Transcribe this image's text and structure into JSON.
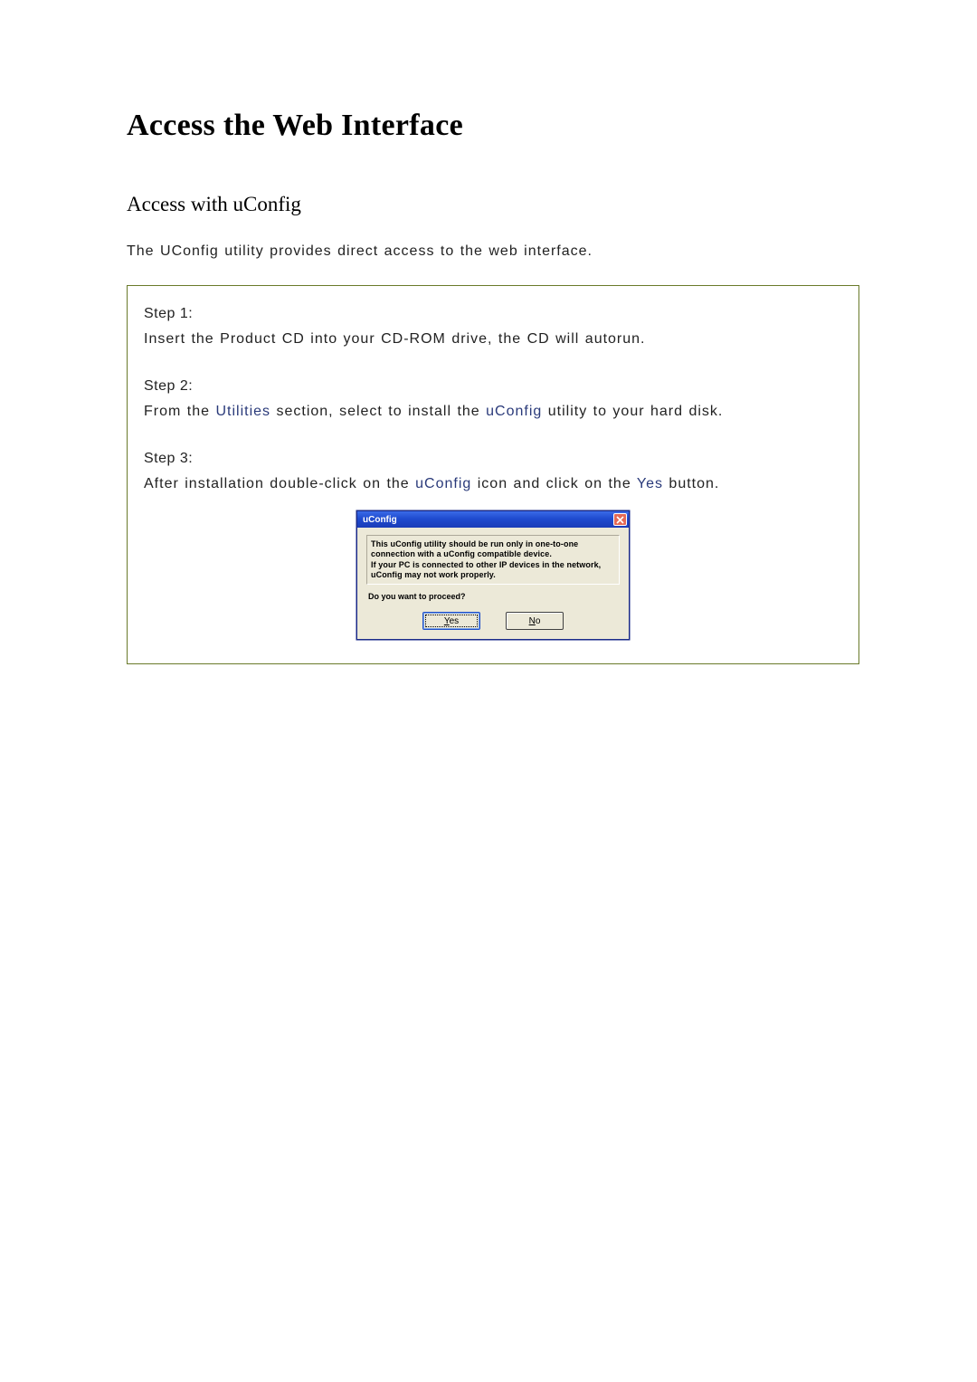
{
  "title": "Access the Web Interface",
  "subtitle": "Access with uConfig",
  "intro": "The UConfig utility provides direct access to the web interface.",
  "steps": {
    "s1": {
      "label": "Step 1:",
      "body": "Insert the Product CD into your CD-ROM drive, the CD will autorun."
    },
    "s2": {
      "label": "Step 2:",
      "pre": "From the ",
      "kw1": "Utilities",
      "mid": " section, select to install the ",
      "kw2": "uConfig",
      "post": " utility to your hard disk."
    },
    "s3": {
      "label": "Step 3:",
      "pre": "After installation double-click on the ",
      "kw1": "uConfig",
      "mid": " icon and click on the ",
      "kw2": "Yes",
      "post": " button."
    }
  },
  "dialog": {
    "title": "uConfig",
    "msg_l1": "This uConfig utility should be run only in one-to-one",
    "msg_l2": "connection with a uConfig compatible device.",
    "msg_l3": "If your PC is connected to other IP devices in the network,",
    "msg_l4": "uConfig may not work properly.",
    "question": "Do you want to proceed?",
    "yes_m": "Y",
    "yes_r": "es",
    "no_m": "N",
    "no_r": "o"
  }
}
